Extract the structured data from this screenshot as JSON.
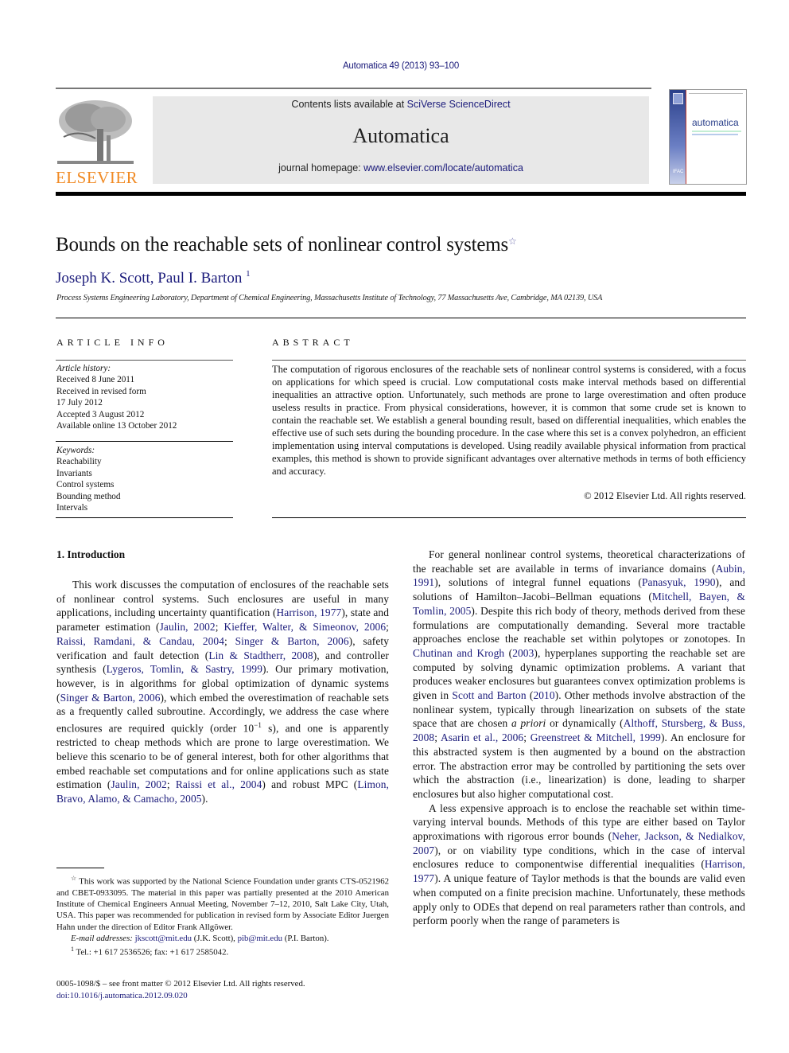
{
  "header": {
    "journal_ref": "Automatica 49 (2013) 93–100",
    "contents_prefix": "Contents lists available at ",
    "contents_link": "SciVerse ScienceDirect",
    "journal_title": "Automatica",
    "homepage_prefix": "journal homepage: ",
    "homepage_link": "www.elsevier.com/locate/automatica",
    "publisher_logo_text": "ELSEVIER",
    "cover_title": "automatica",
    "cover_badge": "IFAC",
    "colors": {
      "link": "#1a1a7a",
      "elsevier_orange": "#f08a24",
      "masthead_bg": "#e8e8e8"
    }
  },
  "article": {
    "title": "Bounds on the reachable sets of nonlinear control systems",
    "title_note_mark": "☆",
    "authors": "Joseph K. Scott, Paul I. Barton",
    "author_note_mark": "1",
    "affiliation": "Process Systems Engineering Laboratory, Department of Chemical Engineering, Massachusetts Institute of Technology, 77 Massachusetts Ave, Cambridge, MA 02139, USA"
  },
  "article_info": {
    "heading": "ARTICLE INFO",
    "history_label": "Article history:",
    "history": [
      "Received 8 June 2011",
      "Received in revised form",
      "17 July 2012",
      "Accepted 3 August 2012",
      "Available online 13 October 2012"
    ],
    "keywords_label": "Keywords:",
    "keywords": [
      "Reachability",
      "Invariants",
      "Control systems",
      "Bounding method",
      "Intervals"
    ]
  },
  "abstract": {
    "heading": "ABSTRACT",
    "text": "The computation of rigorous enclosures of the reachable sets of nonlinear control systems is considered, with a focus on applications for which speed is crucial. Low computational costs make interval methods based on differential inequalities an attractive option. Unfortunately, such methods are prone to large overestimation and often produce useless results in practice. From physical considerations, however, it is common that some crude set is known to contain the reachable set. We establish a general bounding result, based on differential inequalities, which enables the effective use of such sets during the bounding procedure. In the case where this set is a convex polyhedron, an efficient implementation using interval computations is developed. Using readily available physical information from practical examples, this method is shown to provide significant advantages over alternative methods in terms of both efficiency and accuracy.",
    "copyright": "© 2012 Elsevier Ltd. All rights reserved."
  },
  "intro": {
    "heading": "1.  Introduction",
    "left_paragraph": [
      {
        "t": "This work discusses the computation of enclosures of the reachable sets of nonlinear control systems. Such enclosures are useful in many applications, including uncertainty quantification ("
      },
      {
        "l": "Harrison, 1977"
      },
      {
        "t": "), state and parameter estimation ("
      },
      {
        "l": "Jaulin, 2002"
      },
      {
        "t": "; "
      },
      {
        "l": "Kieffer, Walter, & Simeonov, 2006"
      },
      {
        "t": "; "
      },
      {
        "l": "Raissi, Ramdani, & Candau, 2004"
      },
      {
        "t": "; "
      },
      {
        "l": "Singer & Barton, 2006"
      },
      {
        "t": "), safety verification and fault detection ("
      },
      {
        "l": "Lin & Stadtherr, 2008"
      },
      {
        "t": "), and controller synthesis ("
      },
      {
        "l": "Lygeros, Tomlin, & Sastry, 1999"
      },
      {
        "t": "). Our primary motivation, however, is in algorithms for global optimization of dynamic systems ("
      },
      {
        "l": "Singer & Barton, 2006"
      },
      {
        "t": "), which embed the overestimation of reachable sets as a frequently called subroutine. Accordingly, we address the case where enclosures are required quickly (order 10"
      },
      {
        "sup": "−1"
      },
      {
        "t": " s), and one is apparently restricted to cheap methods which are prone to large overestimation. We believe this scenario to be of general interest, both for other algorithms that embed reachable set computations and for online applications such as state estimation ("
      },
      {
        "l": "Jaulin, 2002"
      },
      {
        "t": "; "
      },
      {
        "l": "Raissi et al., 2004"
      },
      {
        "t": ") and robust MPC ("
      },
      {
        "l": "Limon, Bravo, Alamo, & Camacho, 2005"
      },
      {
        "t": ")."
      }
    ],
    "right_paragraph_1": [
      {
        "t": "For general nonlinear control systems, theoretical characterizations of the reachable set are available in terms of invariance domains ("
      },
      {
        "l": "Aubin, 1991"
      },
      {
        "t": "), solutions of integral funnel equations ("
      },
      {
        "l": "Panasyuk, 1990"
      },
      {
        "t": "), and solutions of Hamilton–Jacobi–Bellman equations ("
      },
      {
        "l": "Mitchell, Bayen, & Tomlin, 2005"
      },
      {
        "t": "). Despite this rich body of theory, methods derived from these formulations are computationally demanding. Several more tractable approaches enclose the reachable set within polytopes or zonotopes. In "
      },
      {
        "l": "Chutinan and Krogh"
      },
      {
        "t": " ("
      },
      {
        "l": "2003"
      },
      {
        "t": "), hyperplanes supporting the reachable set are computed by solving dynamic optimization problems. A variant that produces weaker enclosures but guarantees convex optimization problems is given in "
      },
      {
        "l": "Scott and Barton"
      },
      {
        "t": " ("
      },
      {
        "l": "2010"
      },
      {
        "t": "). Other methods involve abstraction of the nonlinear system, typically through linearization on subsets of the state space that are chosen "
      },
      {
        "i": "a priori"
      },
      {
        "t": " or dynamically ("
      },
      {
        "l": "Althoff, Stursberg, & Buss, 2008"
      },
      {
        "t": "; "
      },
      {
        "l": "Asarin et al., 2006"
      },
      {
        "t": "; "
      },
      {
        "l": "Greenstreet & Mitchell, 1999"
      },
      {
        "t": "). An enclosure for this abstracted system is then augmented by a bound on the abstraction error. The abstraction error may be controlled by partitioning the sets over which the abstraction (i.e., linearization) is done, leading to sharper enclosures but also higher computational cost."
      }
    ],
    "right_paragraph_2": [
      {
        "t": "A less expensive approach is to enclose the reachable set within time-varying interval bounds. Methods of this type are either based on Taylor approximations with rigorous error bounds ("
      },
      {
        "l": "Neher, Jackson, & Nedialkov, 2007"
      },
      {
        "t": "), or on viability type conditions, which in the case of interval enclosures reduce to componentwise differential inequalities ("
      },
      {
        "l": "Harrison, 1977"
      },
      {
        "t": "). A unique feature of Taylor methods is that the bounds are valid even when computed on a finite precision machine. Unfortunately, these methods apply only to ODEs that depend on real parameters rather than controls, and perform poorly when the range of parameters is"
      }
    ]
  },
  "footnotes": {
    "funding_mark": "☆",
    "funding": "This work was supported by the National Science Foundation under grants CTS-0521962 and CBET-0933095. The material in this paper was partially presented at the 2010 American Institute of Chemical Engineers Annual Meeting, November 7–12, 2010, Salt Lake City, Utah, USA. This paper was recommended for publication in revised form by Associate Editor Juergen Hahn under the direction of Editor Frank Allgöwer.",
    "email_label": "E-mail addresses: ",
    "email_1": "jkscott@mit.edu",
    "email_1_who": " (J.K. Scott), ",
    "email_2": "pib@mit.edu",
    "email_2_who": " (P.I. Barton).",
    "tel_mark": "1",
    "tel": "Tel.: +1 617 2536526; fax: +1 617 2585042."
  },
  "front_matter": {
    "issn_line": "0005-1098/$ – see front matter © 2012 Elsevier Ltd. All rights reserved.",
    "doi": "doi:10.1016/j.automatica.2012.09.020"
  }
}
